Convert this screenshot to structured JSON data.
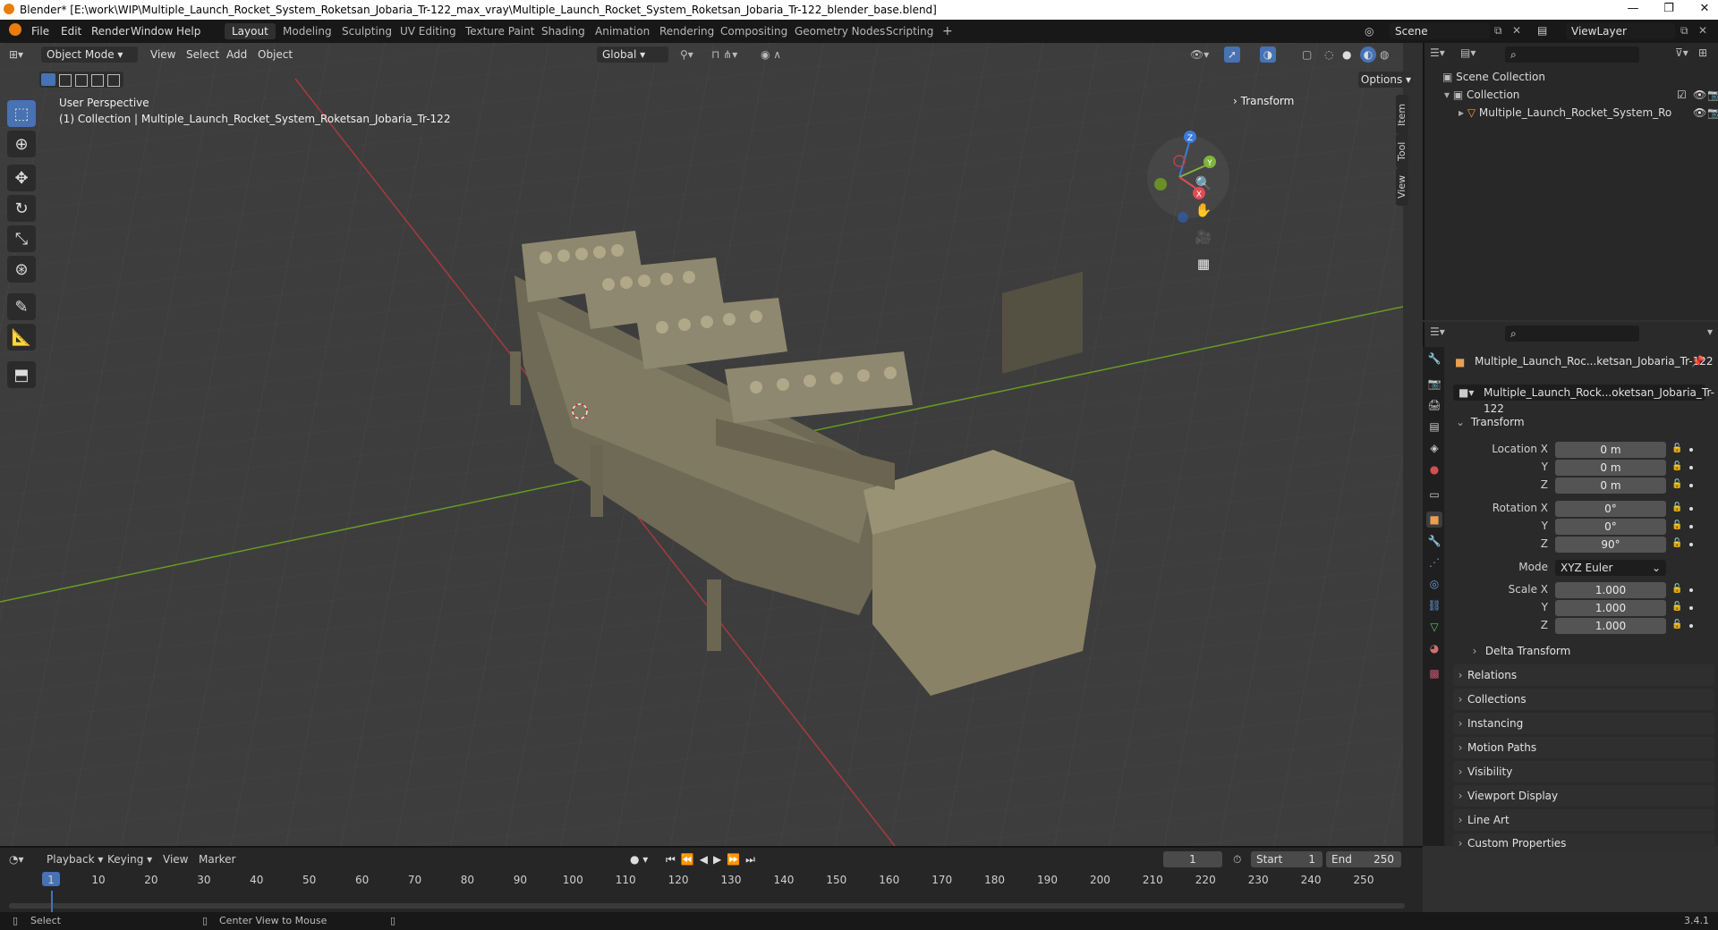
{
  "window": {
    "title": "Blender* [E:\\work\\WIP\\Multiple_Launch_Rocket_System_Roketsan_Jobaria_Tr-122_max_vray\\Multiple_Launch_Rocket_System_Roketsan_Jobaria_Tr-122_blender_base.blend]",
    "minimize": "—",
    "maximize": "❐",
    "close": "✕"
  },
  "menubar": {
    "items": [
      "File",
      "Edit",
      "Render",
      "Window",
      "Help"
    ]
  },
  "workspaces": {
    "active": "Layout",
    "tabs": [
      "Layout",
      "Modeling",
      "Sculpting",
      "UV Editing",
      "Texture Paint",
      "Shading",
      "Animation",
      "Rendering",
      "Compositing",
      "Geometry Nodes",
      "Scripting"
    ],
    "add": "+"
  },
  "scene": {
    "label": "Scene"
  },
  "viewlayer": {
    "label": "ViewLayer"
  },
  "viewport_header": {
    "mode": "Object Mode",
    "menus": [
      "View",
      "Select",
      "Add",
      "Object"
    ],
    "orientation": "Global",
    "options": "Options"
  },
  "viewport_overlay": {
    "perspective": "User Perspective",
    "collection_line": "(1) Collection | Multiple_Launch_Rocket_System_Roketsan_Jobaria_Tr-122",
    "transform_panel": "Transform"
  },
  "side_tabs": [
    "Item",
    "Tool",
    "View"
  ],
  "gizmo": {
    "x": "X",
    "y": "Y",
    "z": "Z"
  },
  "outliner": {
    "root": "Scene Collection",
    "collection": "Collection",
    "object": "Multiple_Launch_Rocket_System_Ro"
  },
  "properties": {
    "object_name": "Multiple_Launch_Roc...ketsan_Jobaria_Tr-122",
    "data_name": "Multiple_Launch_Rock...oketsan_Jobaria_Tr-122",
    "transform_header": "Transform",
    "location_label": "Location X",
    "location": [
      "0 m",
      "0 m",
      "0 m"
    ],
    "rotation_label": "Rotation X",
    "rotation": [
      "0°",
      "0°",
      "90°"
    ],
    "mode_label": "Mode",
    "mode_value": "XYZ Euler",
    "scale_label": "Scale X",
    "scale": [
      "1.000",
      "1.000",
      "1.000"
    ],
    "axis_y": "Y",
    "axis_z": "Z",
    "delta": "Delta Transform",
    "panels": [
      "Relations",
      "Collections",
      "Instancing",
      "Motion Paths",
      "Visibility",
      "Viewport Display",
      "Line Art",
      "Custom Properties"
    ]
  },
  "timeline": {
    "menus": [
      "Playback",
      "Keying",
      "View",
      "Marker"
    ],
    "current_frame": "1",
    "start_label": "Start",
    "start": "1",
    "end_label": "End",
    "end": "250",
    "ticks": [
      "1",
      "10",
      "20",
      "30",
      "40",
      "50",
      "60",
      "70",
      "80",
      "90",
      "100",
      "110",
      "120",
      "130",
      "140",
      "150",
      "160",
      "170",
      "180",
      "190",
      "200",
      "210",
      "220",
      "230",
      "240",
      "250"
    ]
  },
  "statusbar": {
    "select": "Select",
    "center": "Center View to Mouse",
    "version": "3.4.1"
  },
  "colors": {
    "accent": "#4772b3",
    "x_axis": "#b03a3e",
    "y_axis": "#6a9a23",
    "model": "#8a8266"
  }
}
